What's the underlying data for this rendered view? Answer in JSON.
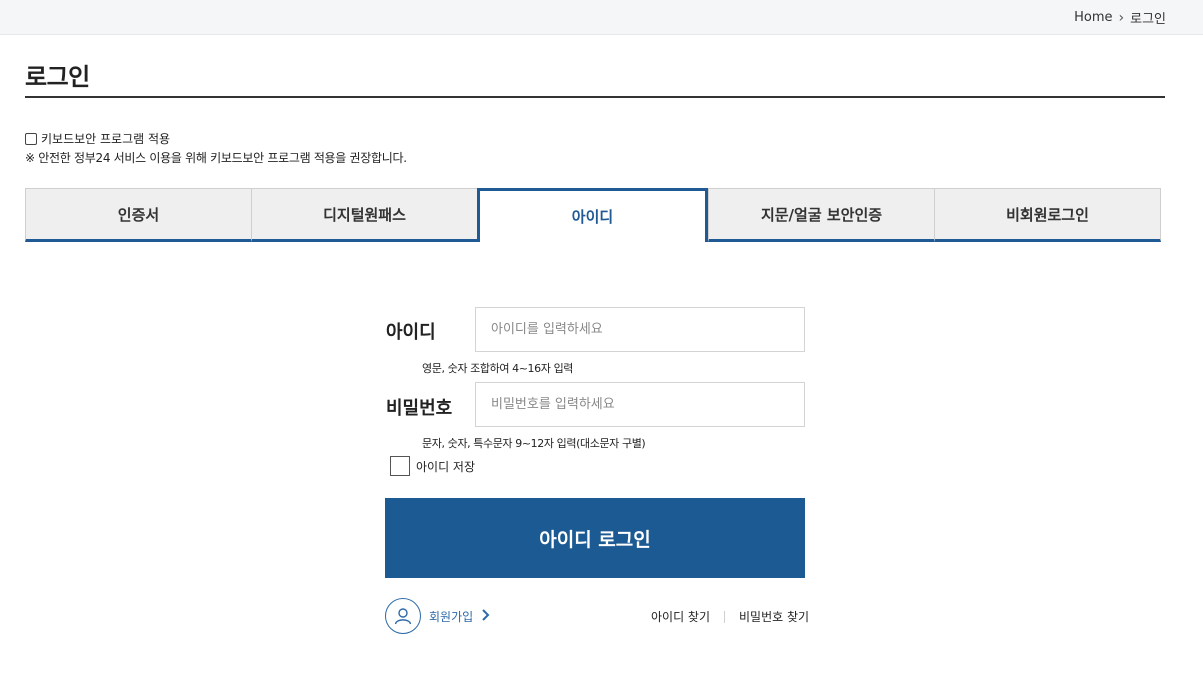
{
  "breadcrumb": {
    "home": "Home",
    "current": "로그인"
  },
  "page": {
    "title": "로그인"
  },
  "keyboard_security": {
    "checkbox_label": "키보드보안 프로그램 적용",
    "note": "※ 안전한 정부24 서비스 이용을 위해 키보드보안 프로그램 적용을 권장합니다."
  },
  "tabs": [
    {
      "label": "인증서"
    },
    {
      "label": "디지털원패스"
    },
    {
      "label": "아이디",
      "active": true
    },
    {
      "label": "지문/얼굴 보안인증"
    },
    {
      "label": "비회원로그인"
    }
  ],
  "form": {
    "id_label": "아이디",
    "id_placeholder": "아이디를 입력하세요",
    "id_hint": "영문, 숫자 조합하여 4~16자 입력",
    "pw_label": "비밀번호",
    "pw_placeholder": "비밀번호를 입력하세요",
    "pw_hint": "문자, 숫자, 특수문자 9~12자 입력(대소문자 구별)",
    "save_id_label": "아이디 저장",
    "login_button": "아이디 로그인"
  },
  "links": {
    "signup": "회원가입",
    "find_id": "아이디 찾기",
    "find_pw": "비밀번호 찾기"
  },
  "colors": {
    "accent": "#1c5a94",
    "link": "#2d6aa8"
  }
}
